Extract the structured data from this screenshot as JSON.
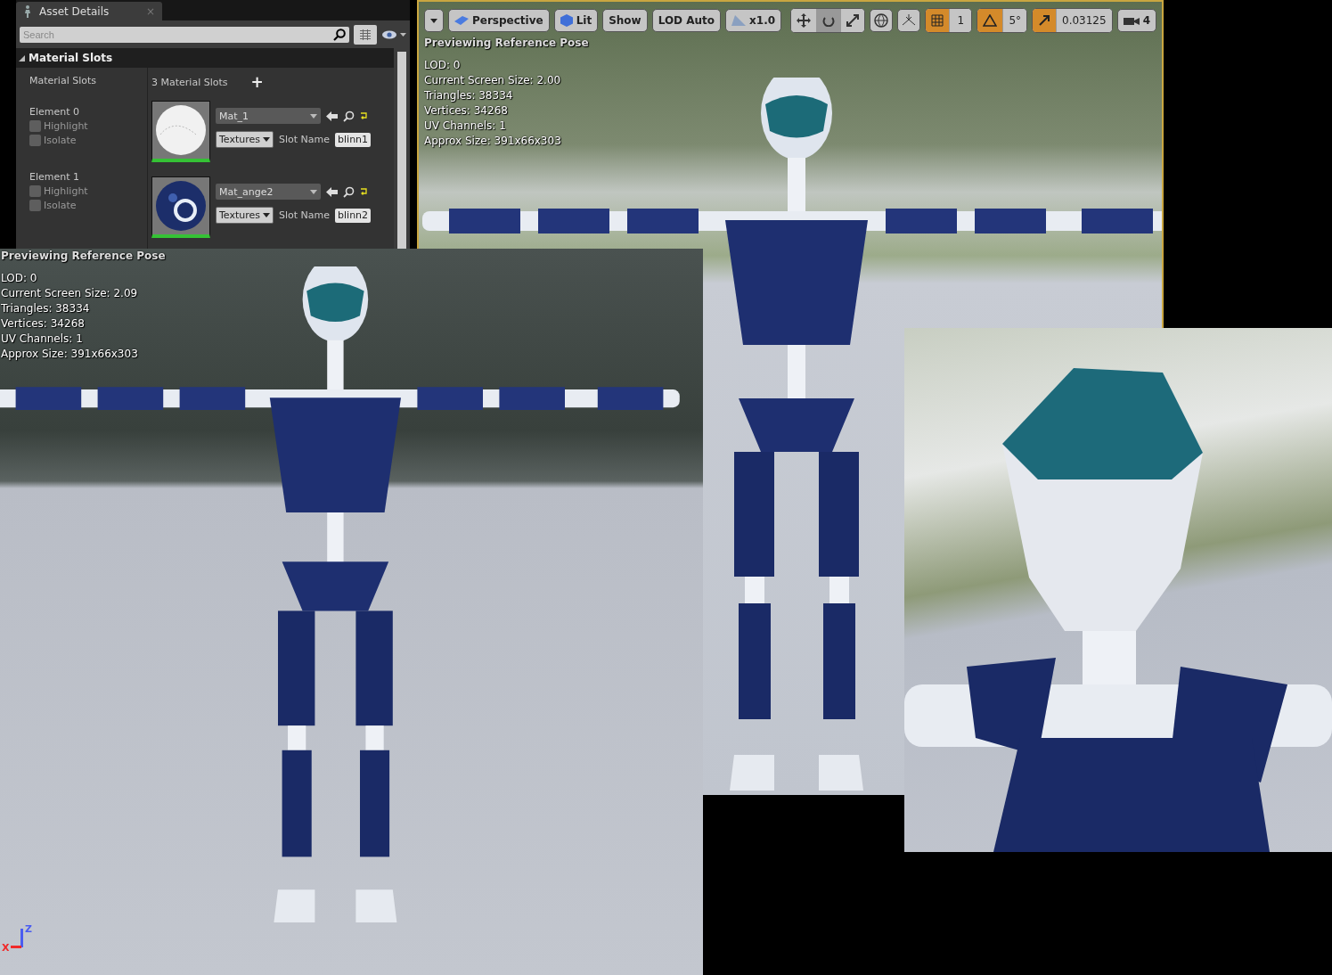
{
  "asset_details": {
    "tab": {
      "title": "Asset Details",
      "close": "×"
    },
    "search": {
      "placeholder": "Search"
    },
    "section": {
      "title": "Material Slots",
      "expanded": true
    },
    "slots_label": "Material Slots",
    "slots_count": "3 Material Slots",
    "add": "+",
    "elements": [
      {
        "label": "Element 0",
        "highlight": {
          "label": "Highlight",
          "checked": false
        },
        "isolate": {
          "label": "Isolate",
          "checked": false
        },
        "kind": "plain",
        "material": "Mat_1",
        "textures": "Textures",
        "slot_name_label": "Slot Name",
        "slot_name": "blinn1"
      },
      {
        "label": "Element 1",
        "highlight": {
          "label": "Highlight",
          "checked": false
        },
        "isolate": {
          "label": "Isolate",
          "checked": false
        },
        "kind": "pattern",
        "material": "Mat_ange2",
        "textures": "Textures",
        "slot_name_label": "Slot Name",
        "slot_name": "blinn2"
      }
    ]
  },
  "viewport_main": {
    "toolbar_left": [
      {
        "kind": "menu"
      },
      {
        "kind": "perspective",
        "label": "Perspective"
      },
      {
        "kind": "lit",
        "label": "Lit"
      },
      {
        "kind": "text",
        "label": "Show"
      },
      {
        "kind": "text",
        "label": "LOD Auto"
      },
      {
        "kind": "speed",
        "label": "x1.0"
      }
    ],
    "snaps": [
      {
        "kind": "grid",
        "label": "1",
        "on": true
      },
      {
        "kind": "rotate",
        "label": "5°",
        "on": true
      },
      {
        "kind": "scale",
        "label": "0.03125",
        "on": true
      }
    ],
    "camera_speed": "4",
    "overlay_title": "Previewing Reference Pose",
    "stats": [
      "LOD: 0",
      "Current Screen Size: 2.00",
      "Triangles: 38334",
      "Vertices: 34268",
      "UV Channels: 1",
      "Approx Size: 391x66x303"
    ]
  },
  "viewport_front": {
    "overlay_title": "Previewing Reference Pose",
    "stats": [
      "LOD: 0",
      "Current Screen Size: 2.09",
      "Triangles: 38334",
      "Vertices: 34268",
      "UV Channels: 1",
      "Approx Size: 391x66x303"
    ],
    "axes": [
      {
        "label": "Z",
        "color": "#4a5cf0"
      },
      {
        "label": "X",
        "color": "#f02a2a"
      }
    ]
  }
}
